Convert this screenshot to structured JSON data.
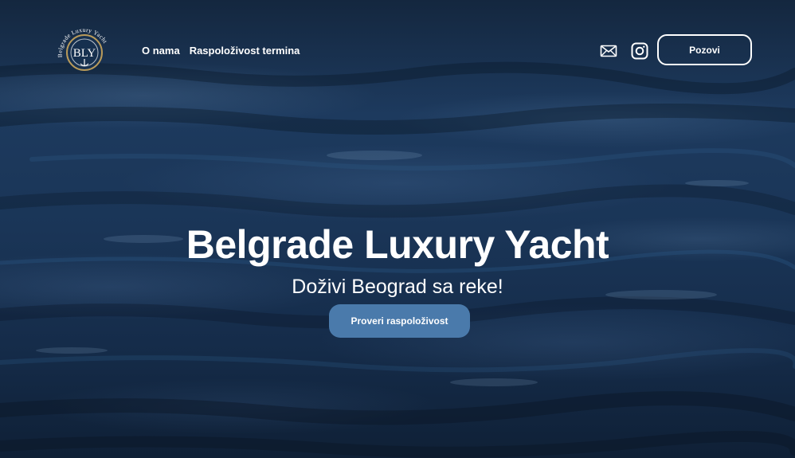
{
  "brand": {
    "logo_text": "Belgrade Luxury Yacht",
    "monogram": "BLY"
  },
  "nav": {
    "links": [
      "O nama",
      "Raspoloživost termina"
    ],
    "icons": [
      "mail-icon",
      "instagram-icon"
    ],
    "call_label": "Pozovi"
  },
  "hero": {
    "title": "Belgrade Luxury Yacht",
    "subtitle": "Doživi Beograd sa reke!",
    "cta_label": "Proveri raspoloživost"
  },
  "colors": {
    "water_dark": "#14273f",
    "water_mid": "#1d3a5e",
    "cta_background": "#4a7aab",
    "logo_gold": "#b89a5a",
    "text": "#ffffff"
  }
}
